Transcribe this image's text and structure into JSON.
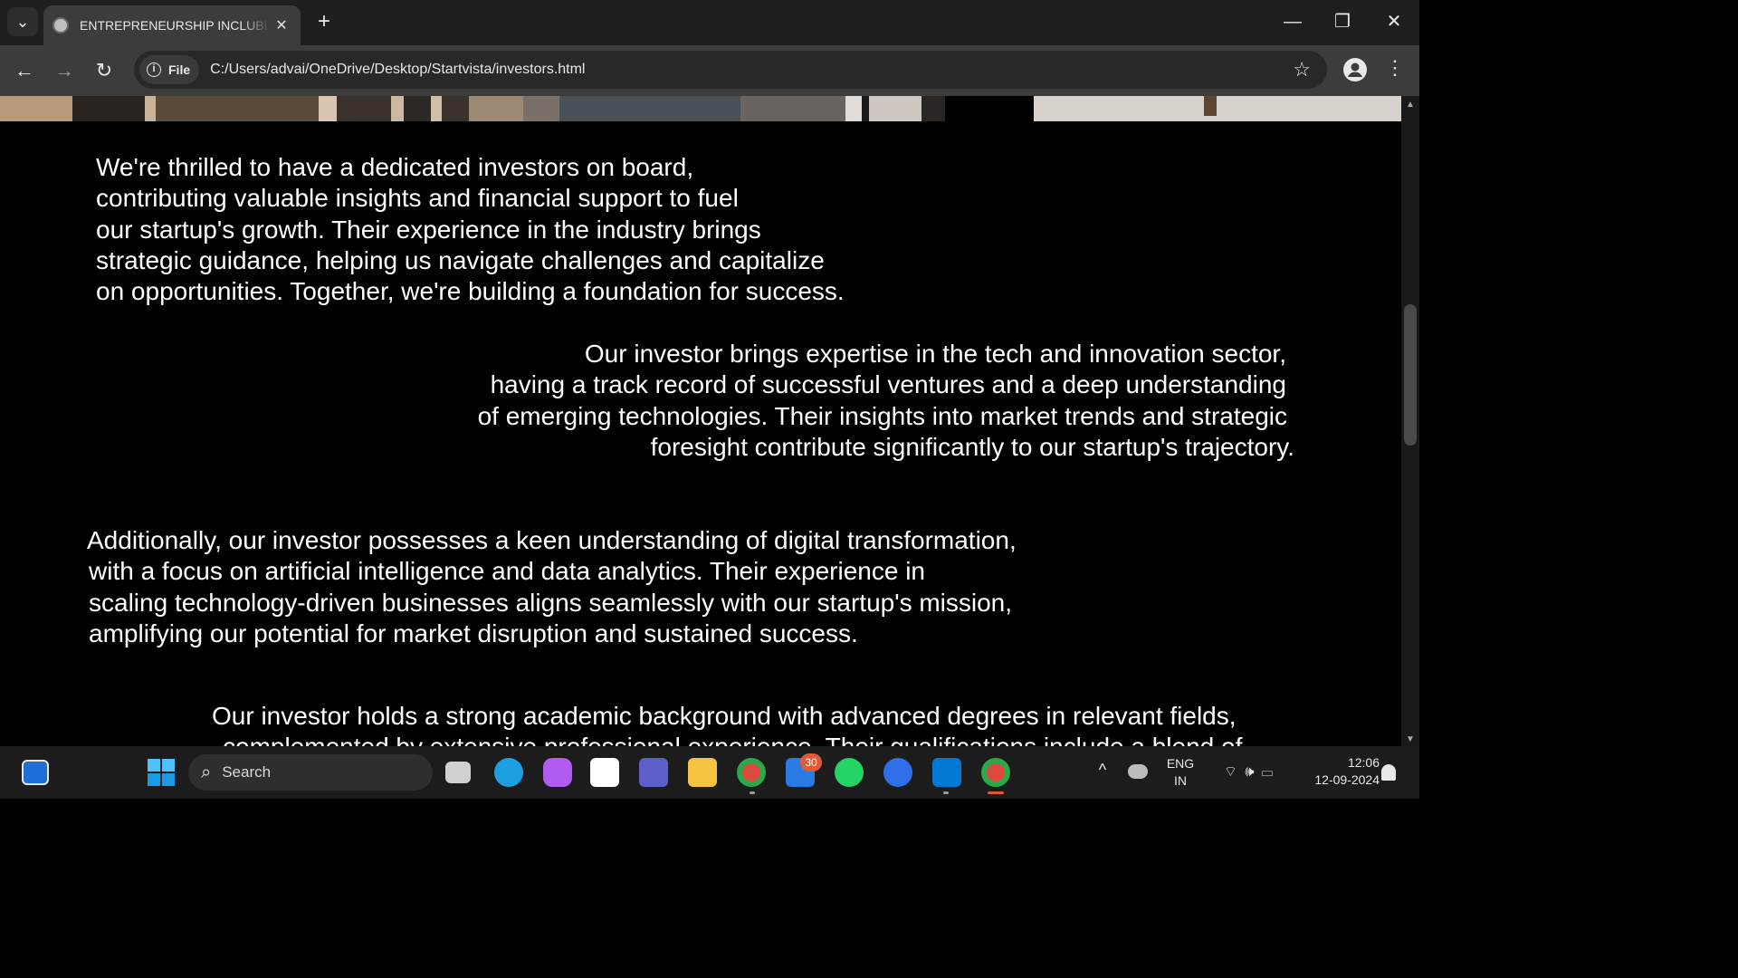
{
  "browser": {
    "tab_title": "ENTREPRENEURSHIP INCLUBLA",
    "tab_close": "✕",
    "new_tab": "+",
    "minimize": "—",
    "maximize": "❐",
    "close": "✕",
    "back": "←",
    "forward": "→",
    "reload": "↻",
    "site_info_label": "File",
    "info_glyph": "i",
    "url": "C:/Users/advai/OneDrive/Desktop/Startvista/investors.html",
    "bookmark": "☆",
    "menu": "⋮",
    "tab_search": "⌄"
  },
  "page": {
    "paragraphs": [
      {
        "lines": [
          "We're thrilled to have a dedicated investors on board,",
          "contributing valuable insights and financial support to fuel",
          "our startup's growth. Their experience in the industry brings",
          "strategic guidance, helping us navigate challenges and capitalize",
          "on opportunities. Together, we're building a foundation for success."
        ]
      },
      {
        "lines": [
          "Our investor brings expertise in the tech and innovation sector,",
          "having a track record of successful ventures and a deep understanding",
          "of emerging technologies. Their insights into market trends and strategic",
          "foresight contribute significantly to our startup's trajectory."
        ]
      },
      {
        "lines": [
          "Additionally, our investor possesses a keen understanding of digital transformation,",
          "with a focus on artificial intelligence and data analytics. Their experience in",
          "scaling technology-driven businesses aligns seamlessly with our startup's mission,",
          "amplifying our potential for market disruption and sustained success."
        ]
      },
      {
        "lines": [
          "Our investor holds a strong academic background with advanced degrees in relevant fields,",
          "complemented by extensive professional experience. Their qualifications include a blend of"
        ]
      }
    ]
  },
  "scrollbar": {
    "up": "▲",
    "down": "▼"
  },
  "taskbar": {
    "search_label": "Search",
    "search_glyph": "⌕",
    "teams_badge": "30",
    "tray_chevron": "^",
    "language": "ENG",
    "region": "IN",
    "time": "12:06",
    "date": "12-09-2024",
    "tray_icons": "⌔ 🕪 ▭"
  },
  "colors": {
    "page_background": "#000000",
    "text": "#ffffff",
    "tab_bar": "#1f1f1f",
    "toolbar": "#3c3c3c",
    "taskbar": "#1c1c1c"
  }
}
